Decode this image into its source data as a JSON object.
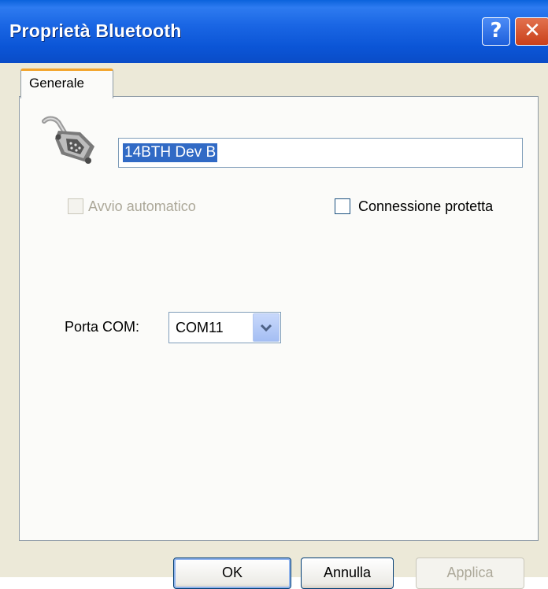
{
  "window": {
    "title": "Proprietà Bluetooth",
    "help_label": "?",
    "close_label": "✕"
  },
  "tabs": [
    {
      "label": "Generale",
      "active": true
    }
  ],
  "device": {
    "icon": "serial-port-icon",
    "name": "14BTH Dev B"
  },
  "options": {
    "auto_start_label": "Avvio automatico",
    "auto_start_checked": false,
    "auto_start_enabled": false,
    "secure_label": "Connessione protetta",
    "secure_checked": false
  },
  "com_port": {
    "label": "Porta COM:",
    "value": "COM11"
  },
  "buttons": {
    "ok": "OK",
    "cancel": "Annulla",
    "apply": "Applica",
    "apply_enabled": false
  },
  "colors": {
    "titlebar": "#0b55d6",
    "tab_accent": "#f3a42c",
    "selection": "#316ac5",
    "disabled_text": "#aca899"
  }
}
